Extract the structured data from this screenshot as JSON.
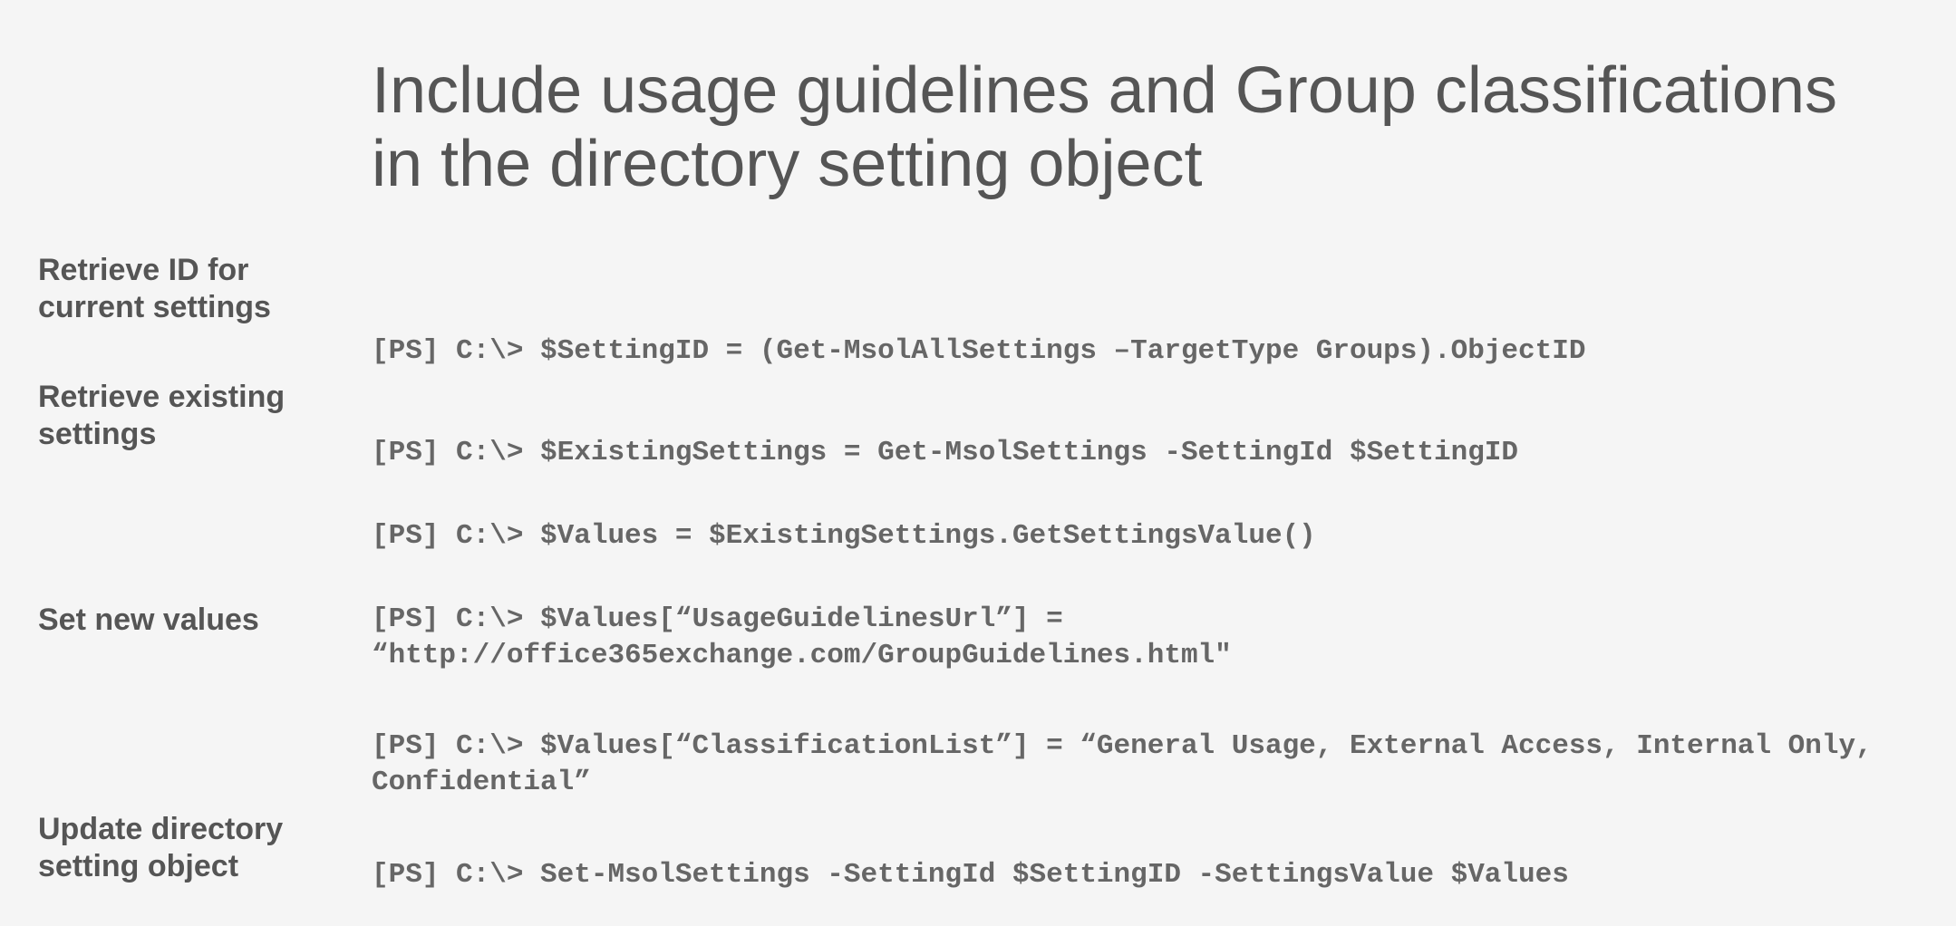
{
  "title": "Include usage guidelines and Group classifications in the directory setting object",
  "labels": {
    "retrieve_id": "Retrieve ID for current settings",
    "retrieve_existing": "Retrieve existing settings",
    "set_new": "Set new values",
    "update_obj": "Update directory setting object"
  },
  "code": {
    "line1": "[PS] C:\\> $SettingID = (Get-MsolAllSettings –TargetType Groups).ObjectID",
    "line2": "[PS] C:\\> $ExistingSettings = Get-MsolSettings -SettingId $SettingID",
    "line3": "[PS] C:\\> $Values = $ExistingSettings.GetSettingsValue()",
    "line4": "[PS] C:\\> $Values[“UsageGuidelinesUrl”] = “http://office365exchange.com/GroupGuidelines.html\"",
    "line5": "[PS] C:\\> $Values[“ClassificationList”] = “General Usage, External Access, Internal Only, Confidential”",
    "line6": "[PS] C:\\> Set-MsolSettings -SettingId $SettingID -SettingsValue $Values"
  }
}
